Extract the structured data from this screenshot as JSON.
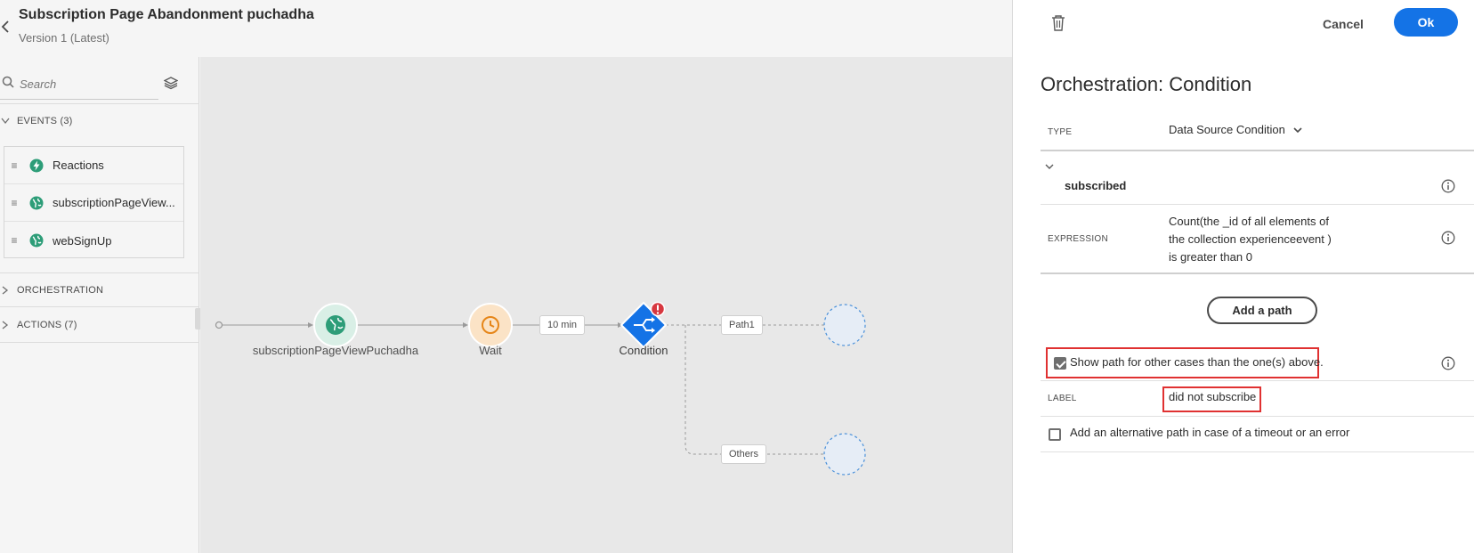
{
  "header": {
    "title": "Subscription Page Abandonment puchadha",
    "version": "Version 1 (Latest)",
    "back_icon": "chevron-left-icon"
  },
  "palette": {
    "search_placeholder": "Search",
    "sections": {
      "events": "EVENTS (3)",
      "orchestration": "ORCHESTRATION",
      "actions": "ACTIONS (7)"
    },
    "events": [
      {
        "label": "Reactions",
        "icon": "bolt-icon"
      },
      {
        "label": "subscriptionPageView...",
        "icon": "globe-icon"
      },
      {
        "label": "webSignUp",
        "icon": "globe-icon"
      }
    ]
  },
  "canvas": {
    "nodes": {
      "event_label": "subscriptionPageViewPuchadha",
      "wait_label": "Wait",
      "wait_duration": "10 min",
      "condition_label": "Condition",
      "condition_error_icon": "exclamation-icon"
    },
    "paths": {
      "path1": "Path1",
      "others": "Others"
    }
  },
  "panel": {
    "cancel": "Cancel",
    "ok": "Ok",
    "title": "Orchestration: Condition",
    "type_label": "TYPE",
    "type_value": "Data Source Condition",
    "condition_name": "subscribed",
    "expression_label": "EXPRESSION",
    "expression_lines": [
      "Count(the _id of all elements of",
      "the collection experienceevent )",
      "is greater than 0"
    ],
    "add_path": "Add a path",
    "show_other_path": {
      "label": "Show path for other cases than the one(s) above.",
      "checked": true
    },
    "label_label": "LABEL",
    "label_value": "did not subscribe",
    "alt_path": {
      "label": "Add an alternative path in case of a timeout or an error",
      "checked": false
    }
  },
  "colors": {
    "accent_blue": "#1473e6",
    "event_green": "#2d9d78",
    "wait_orange": "#e68619",
    "error_red": "#d7373f",
    "highlight_red": "#e03131"
  }
}
